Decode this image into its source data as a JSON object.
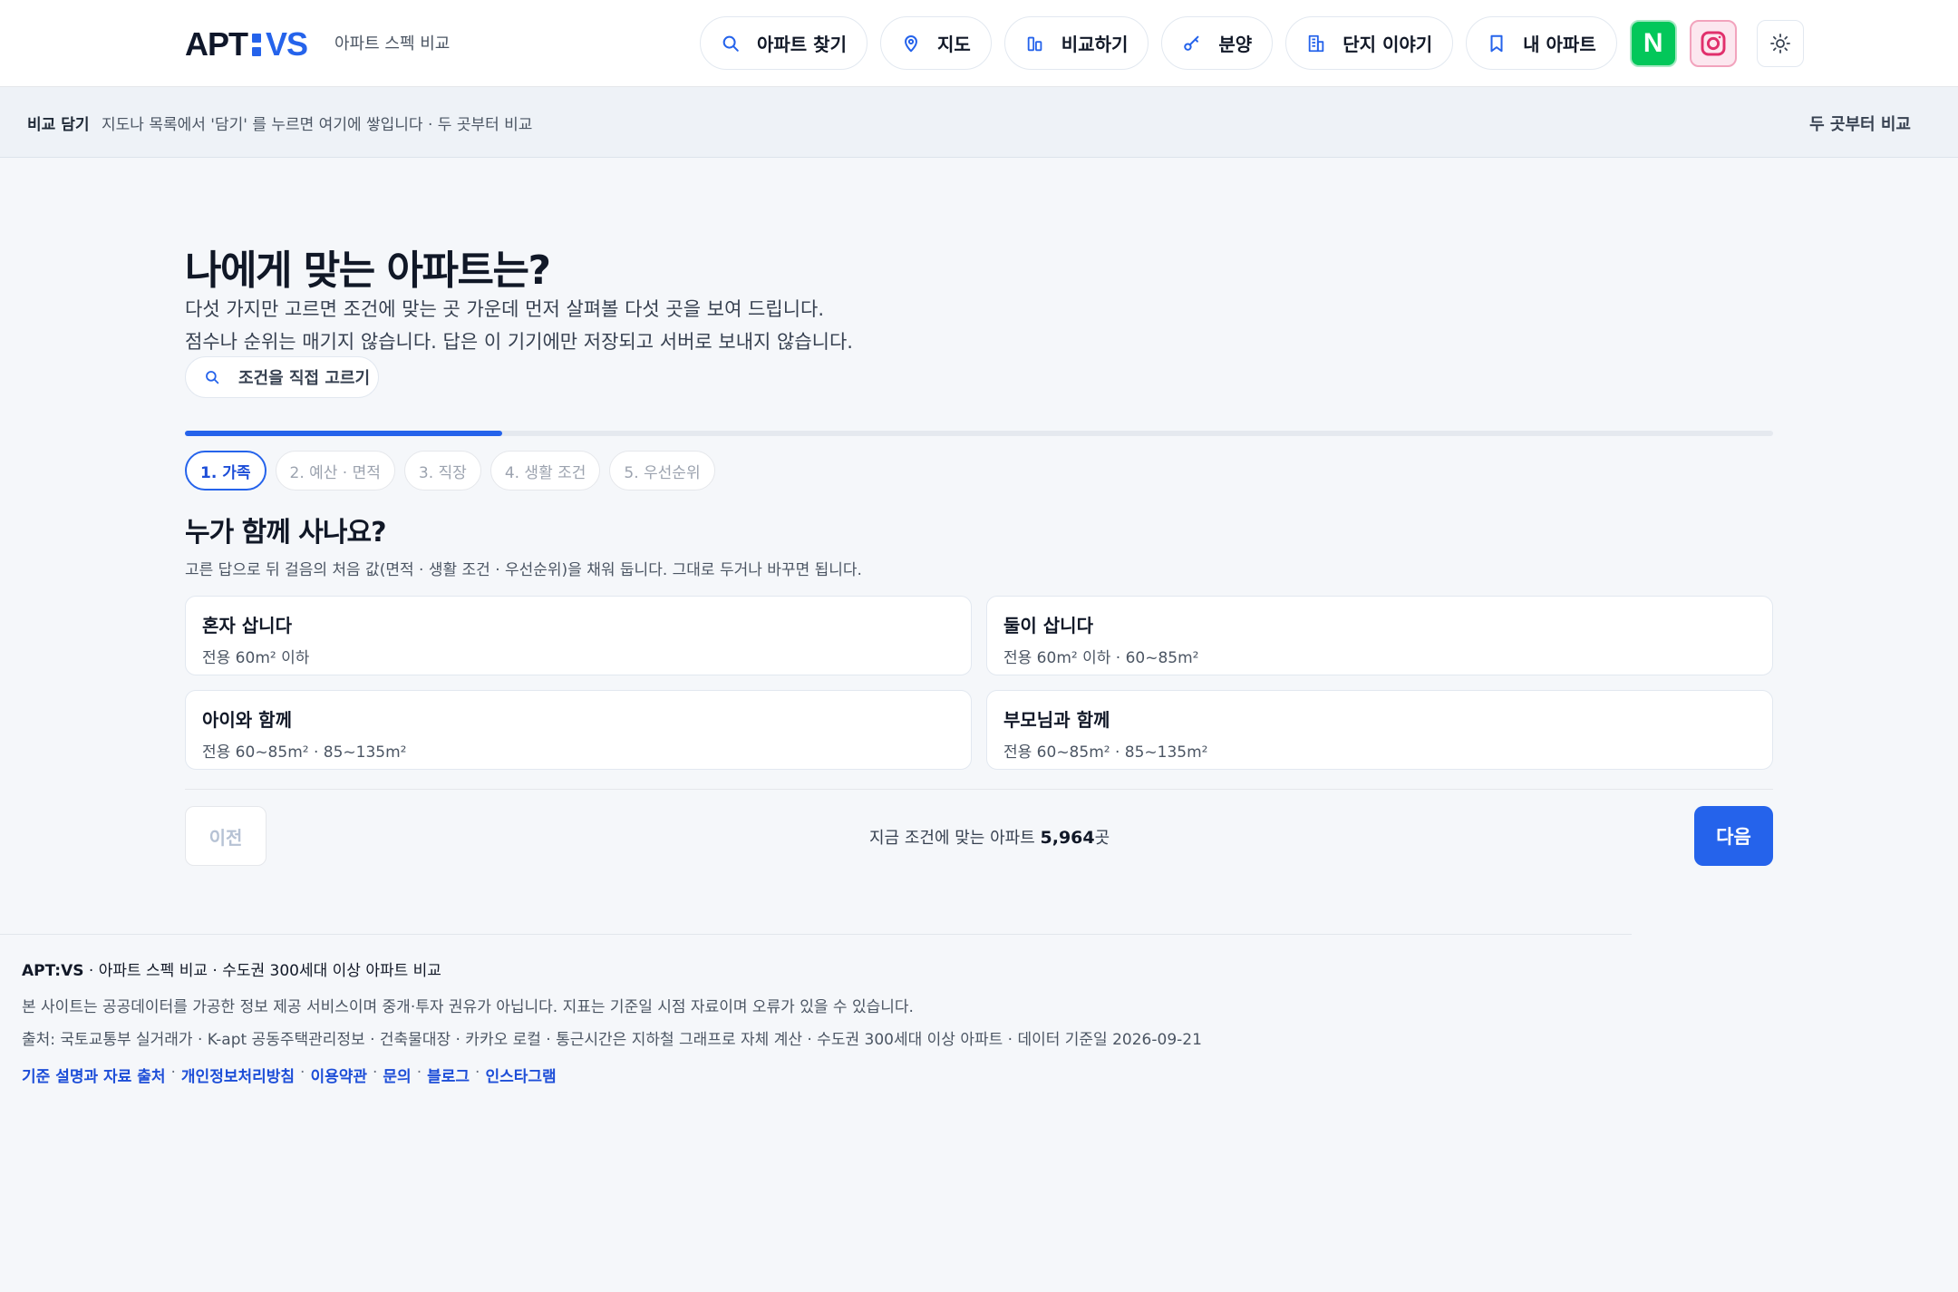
{
  "header": {
    "logo_main": "APT",
    "logo_vs": "VS",
    "tagline": "아파트 스펙 비교",
    "nav": [
      {
        "label": "아파트 찾기",
        "icon": "search-icon"
      },
      {
        "label": "지도",
        "icon": "map-pin-icon"
      },
      {
        "label": "비교하기",
        "icon": "compare-icon"
      },
      {
        "label": "분양",
        "icon": "key-icon"
      },
      {
        "label": "단지 이야기",
        "icon": "building-icon"
      },
      {
        "label": "내 아파트",
        "icon": "bookmark-icon"
      }
    ],
    "naver_glyph": "N",
    "colors": {
      "accent": "#2563eb",
      "naver": "#03c75a",
      "instagram": "#e1306c"
    }
  },
  "compare_bar": {
    "title": "비교 담기",
    "hint": "지도나 목록에서 '담기' 를 누르면 여기에 쌓입니다 · 두 곳부터 비교",
    "right": "두 곳부터 비교"
  },
  "main": {
    "title": "나에게 맞는 아파트는?",
    "desc1": "다섯 가지만 고르면 조건에 맞는 곳 가운데 먼저 살펴볼 다섯 곳을 보여 드립니다.",
    "desc2": "점수나 순위는 매기지 않습니다. 답은 이 기기에만 저장되고 서버로 보내지 않습니다.",
    "direct_label": "조건을 직접 고르기",
    "progress": 0.2,
    "steps": [
      {
        "label": "1. 가족",
        "active": true
      },
      {
        "label": "2. 예산 · 면적",
        "active": false
      },
      {
        "label": "3. 직장",
        "active": false
      },
      {
        "label": "4. 생활 조건",
        "active": false
      },
      {
        "label": "5. 우선순위",
        "active": false
      }
    ],
    "question": "누가 함께 사나요?",
    "question_sub": "고른 답으로 뒤 걸음의 처음 값(면적 · 생활 조건 · 우선순위)을 채워 둡니다. 그대로 두거나 바꾸면 됩니다.",
    "options": [
      {
        "title": "혼자 삽니다",
        "sub": "전용 60m² 이하"
      },
      {
        "title": "둘이 삽니다",
        "sub": "전용 60m² 이하 · 60~85m²"
      },
      {
        "title": "아이와 함께",
        "sub": "전용 60~85m² · 85~135m²"
      },
      {
        "title": "부모님과 함께",
        "sub": "전용 60~85m² · 85~135m²"
      }
    ],
    "prev_label": "이전",
    "count_prefix": "지금 조건에 맞는 아파트 ",
    "count_value": "5,964",
    "count_suffix": "곳",
    "next_label": "다음"
  },
  "footer": {
    "brand": "APT:VS",
    "line1": " · 아파트 스펙 비교 · 수도권 300세대 이상 아파트 비교",
    "line2": "본 사이트는 공공데이터를 가공한 정보 제공 서비스이며 중개·투자 권유가 아닙니다. 지표는 기준일 시점 자료이며 오류가 있을 수 있습니다.",
    "line3": "출처: 국토교통부 실거래가 · K-apt 공동주택관리정보 · 건축물대장 · 카카오 로컬 · 통근시간은 지하철 그래프로 자체 계산 · 수도권 300세대 이상 아파트 · 데이터 기준일 2026-09-21",
    "links": [
      "기준 설명과 자료 출처",
      "개인정보처리방침",
      "이용약관",
      "문의",
      "블로그",
      "인스타그램"
    ]
  }
}
